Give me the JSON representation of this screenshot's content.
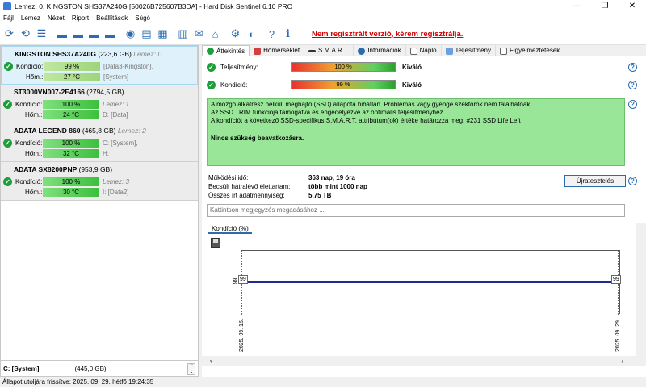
{
  "window": {
    "title": "Lemez: 0, KINGSTON SHS37A240G [50026B725607B3DA]  -  Hard Disk Sentinel 6.10 PRO",
    "controls": [
      "—",
      "❐",
      "✕"
    ]
  },
  "menu": [
    "Fájl",
    "Lemez",
    "Nézet",
    "Riport",
    "Beállítások",
    "Súgó"
  ],
  "toolbar": {
    "nag_text": "Nem regisztrált verzió, kérem regisztrálja."
  },
  "disks": [
    {
      "name": "KINGSTON SHS37A240G",
      "size": "(223,6 GB)",
      "lemez": "Lemez: 0",
      "condition_label": "Kondíció:",
      "condition": "99 %",
      "temp_label": "Hőm.:",
      "temp": "27 °C",
      "part1": "[Data3-Kingston],",
      "part2": "[System]"
    },
    {
      "name": "ST3000VN007-2E4166",
      "size": "(2794,5 GB)",
      "lemez": "Lemez: 1",
      "condition_label": "Kondíció:",
      "condition": "100 %",
      "temp_label": "Hőm.:",
      "temp": "24 °C",
      "part1": "",
      "part2": "D: [Data]"
    },
    {
      "name": "ADATA LEGEND 860",
      "size": "(465,8 GB)",
      "lemez": "Lemez: 2",
      "condition_label": "Kondíció:",
      "condition": "100 %",
      "temp_label": "Hőm.:",
      "temp": "32 °C",
      "part1": "C: [System],",
      "part2": "H:"
    },
    {
      "name": "ADATA SX8200PNP",
      "size": "(953,9 GB)",
      "lemez": "Lemez: 3",
      "condition_label": "Kondíció:",
      "condition": "100 %",
      "temp_label": "Hőm.:",
      "temp": "30 °C",
      "part1": "",
      "part2": "I: [Data2]"
    }
  ],
  "drive_selector": {
    "drive": "C: [System]",
    "capacity": "(445,0 GB)"
  },
  "statusbar": "Állapot utoljára frissítve: 2025. 09. 29. hétfő 19:24:35",
  "tabs": [
    "Áttekintés",
    "Hőmérséklet",
    "S.M.A.R.T.",
    "Információk",
    "Napló",
    "Teljesítmény",
    "Figyelmeztetések"
  ],
  "overview": {
    "performance_label": "Teljesítmény:",
    "performance_value": "100 %",
    "performance_rating": "Kiváló",
    "condition_label": "Kondíció:",
    "condition_value": "99 %",
    "condition_rating": "Kiváló",
    "info_lines": [
      "A mozgó alkatrész nélküli meghajtó (SSD) állapota hibátlan. Problémás vagy gyenge szektorok nem találhatóak.",
      "Az SSD TRIM funkciója támogatva és engedélyezve az optimális teljesítményhez.",
      "A kondíciót a következő SSD-specifikus S.M.A.R.T. attribútum(ok) értéke határozza meg:  #231 SSD Life Left"
    ],
    "info_bold": "Nincs szükség beavatkozásra.",
    "uptime_label": "Működési idő:",
    "uptime_value": "363 nap, 19 óra",
    "remaining_label": "Becsült hátralévő élettartam:",
    "remaining_value": "több mint 1000 nap",
    "written_label": "Összes írt adatmennyiség:",
    "written_value": "5,75 TB",
    "retest_label": "Újratesztelés",
    "comment_placeholder": "Kattintson megjegyzés megadásához ..."
  },
  "chart_tab": "Kondíció  (%)",
  "chart_data": {
    "type": "line",
    "x": [
      "2025. 09. 15.",
      "2025. 09. 29."
    ],
    "series": [
      {
        "values": [
          99,
          99
        ]
      }
    ],
    "data_labels": [
      "99",
      "99"
    ],
    "y_tick": "99",
    "color": "#1f2a8f"
  }
}
